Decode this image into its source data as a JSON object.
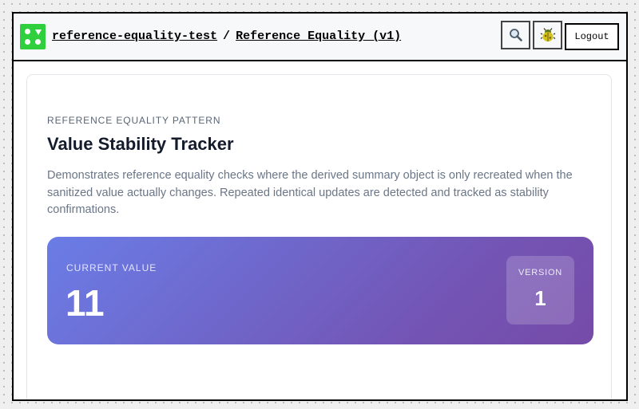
{
  "header": {
    "logo_icon": "four-dot-logo-icon",
    "logo_color": "#2fcf3e",
    "breadcrumb": {
      "project": "reference-equality-test",
      "separator": "/",
      "page": "Reference Equality (v1)"
    },
    "search_icon": "magnifier-icon",
    "debug_icon": "bug-icon",
    "logout_label": "Logout"
  },
  "card": {
    "eyebrow": "REFERENCE EQUALITY PATTERN",
    "title": "Value Stability Tracker",
    "description": "Demonstrates reference equality checks where the derived summary object is only recreated when the sanitized value actually changes. Repeated identical updates are detected and tracked as stability confirmations.",
    "panel": {
      "current_value_label": "CURRENT VALUE",
      "current_value": "11",
      "version_label": "VERSION",
      "version_value": "1",
      "gradient_start": "#6a7de6",
      "gradient_end": "#764ba8"
    }
  }
}
